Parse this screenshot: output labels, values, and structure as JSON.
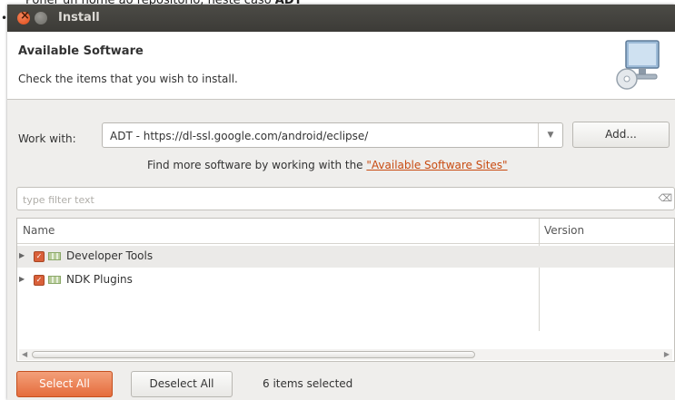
{
  "caption": {
    "prefix": "Poñer un nome ao repositorio, neste caso ",
    "bold": "ADT"
  },
  "bullet": "•",
  "window": {
    "title": "Install"
  },
  "header": {
    "title": "Available Software",
    "description": "Check the items that you wish to install."
  },
  "work_with": {
    "label": "Work with:",
    "value": "ADT - https://dl-ssl.google.com/android/eclipse/",
    "add_label": "Add..."
  },
  "find_more": {
    "text": "Find more software by working with the ",
    "link": "\"Available Software Sites\""
  },
  "filter": {
    "placeholder": "type filter text"
  },
  "tree": {
    "columns": [
      "Name",
      "Version"
    ],
    "rows": [
      {
        "label": "Developer Tools",
        "checked": true,
        "selected": true
      },
      {
        "label": "NDK Plugins",
        "checked": true,
        "selected": false
      }
    ]
  },
  "buttons": {
    "select_all": "Select All",
    "deselect_all": "Deselect All"
  },
  "status": {
    "selected_count": "6 items selected"
  },
  "colors": {
    "accent": "#e56c3c",
    "titlebar": "#3c3b37",
    "link": "#c84b11"
  },
  "icons": [
    "close-icon",
    "minimize-icon",
    "install-computer-icon",
    "combo-arrow-icon",
    "clear-filter-icon",
    "expand-arrow-icon",
    "checkbox-icon",
    "package-icon"
  ]
}
